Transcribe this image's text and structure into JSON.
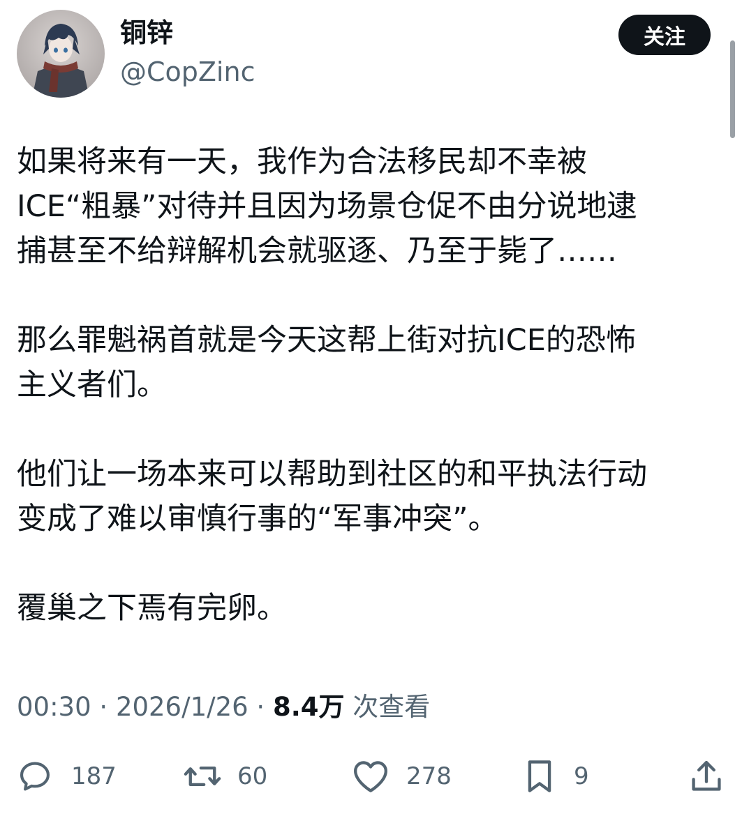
{
  "author": {
    "display_name": "铜锌",
    "handle": "@CopZinc"
  },
  "follow_button": {
    "label": "关注"
  },
  "tweet": {
    "paragraphs": [
      [
        "如果将来有一天，我作为合法移民却不幸被",
        "ICE“粗暴”对待并且因为场景仓促不由分说地逮",
        "捕甚至不给辩解机会就驱逐、乃至于毙了……"
      ],
      [
        "那么罪魁祸首就是今天这帮上街对抗ICE的恐怖",
        "主义者们。"
      ],
      [
        "他们让一场本来可以帮助到社区的和平执法行动",
        "变成了难以审慎行事的“军事冲突”。"
      ],
      [
        "覆巢之下焉有完卵。"
      ]
    ]
  },
  "meta": {
    "time": "00:30",
    "sep1": " · ",
    "date": "2026/1/26",
    "sep2": " · ",
    "views_count": "8.4万",
    "views_label": " 次查看"
  },
  "actions": {
    "replies": "187",
    "reposts": "60",
    "likes": "278",
    "bookmarks": "9"
  },
  "icons": {
    "reply": "reply-icon",
    "repost": "repost-icon",
    "like": "heart-icon",
    "bookmark": "bookmark-icon",
    "share": "share-icon"
  },
  "colors": {
    "text": "#0f1419",
    "secondary": "#536471",
    "button_bg": "#0f1419",
    "button_text": "#ffffff"
  }
}
